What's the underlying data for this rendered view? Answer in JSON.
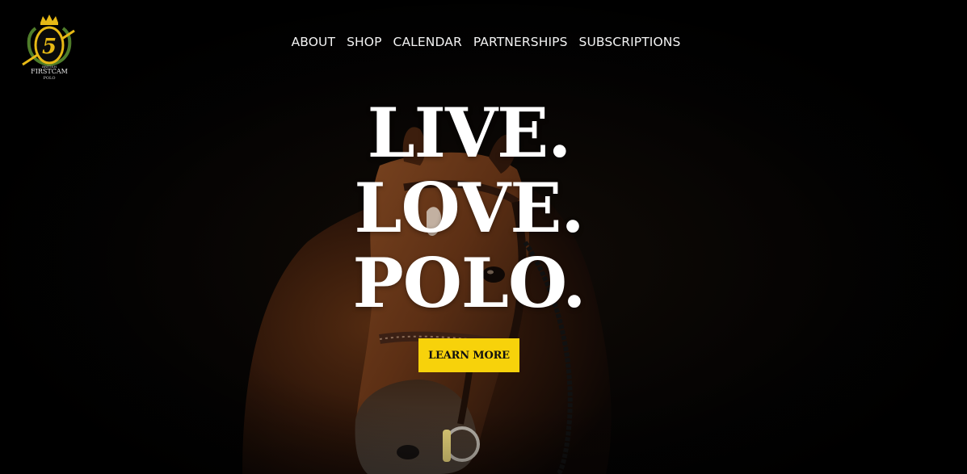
{
  "brand": {
    "logo_top_text": "BRITISH",
    "logo_name": "FIRSTCAM",
    "logo_sub": "POLO",
    "logo_monogram": "5",
    "accent_color": "#f7d20b"
  },
  "nav": {
    "items": [
      {
        "label": "ABOUT"
      },
      {
        "label": "SHOP"
      },
      {
        "label": "CALENDAR"
      },
      {
        "label": "PARTNERSHIPS"
      },
      {
        "label": "SUBSCRIPTIONS"
      }
    ]
  },
  "hero": {
    "lines": [
      "LIVE.",
      "LOVE.",
      "POLO."
    ],
    "cta_label": "LEARN MORE",
    "image_subject": "horse-portrait"
  }
}
